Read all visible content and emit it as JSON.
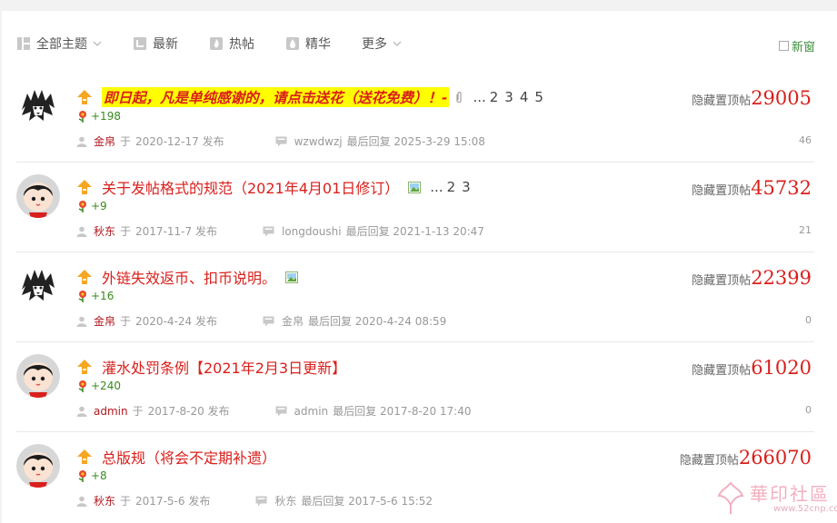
{
  "filters": {
    "all_topics": "全部主题",
    "latest": "最新",
    "hot": "热帖",
    "digest": "精华",
    "more": "更多"
  },
  "new_window_label": "新窗",
  "threads": [
    {
      "title": "即日起，凡是单纯感谢的，请点击送花（送花免费）！-",
      "highlight": true,
      "has_attachment": true,
      "pages": [
        "...",
        "2",
        "3",
        "4",
        "5"
      ],
      "flowers": "+198",
      "author": "金帛",
      "posted_prefix": "于",
      "posted": "2020-12-17 发布",
      "last_user": "wzwdwzj",
      "last_reply": "最后回复 2025-3-29 15:08",
      "pin_label": "隐藏置顶帖",
      "views": "29005",
      "replies": "46",
      "avatar": "lion"
    },
    {
      "title": "关于发帖格式的规范（2021年4月01日修订）",
      "highlight": false,
      "has_image": true,
      "pages": [
        "...",
        "2",
        "3"
      ],
      "flowers": "+9",
      "author": "秋东",
      "posted_prefix": "于",
      "posted": "2017-11-7 发布",
      "last_user": "longdoushi",
      "last_reply": "最后回复 2021-1-13 20:47",
      "pin_label": "隐藏置顶帖",
      "views": "45732",
      "replies": "21",
      "avatar": "girl"
    },
    {
      "title": "外链失效返币、扣币说明。",
      "highlight": false,
      "has_image": true,
      "pages": [],
      "flowers": "+16",
      "author": "金帛",
      "posted_prefix": "于",
      "posted": "2020-4-24 发布",
      "last_user": "金帛",
      "last_reply": "最后回复 2020-4-24 08:59",
      "pin_label": "隐藏置顶帖",
      "views": "22399",
      "replies": "0",
      "avatar": "lion"
    },
    {
      "title": "灌水处罚条例【2021年2月3日更新】",
      "highlight": false,
      "pages": [],
      "flowers": "+240",
      "author": "admin",
      "posted_prefix": "于",
      "posted": "2017-8-20 发布",
      "last_user": "admin",
      "last_reply": "最后回复 2017-8-20 17:40",
      "pin_label": "隐藏置顶帖",
      "views": "61020",
      "replies": "0",
      "avatar": "girl"
    },
    {
      "title": "总版规（将会不定期补遗）",
      "highlight": false,
      "pages": [],
      "flowers": "+8",
      "author": "秋东",
      "posted_prefix": "于",
      "posted": "2017-5-6 发布",
      "last_user": "秋东",
      "last_reply": "最后回复 2017-5-6 15:52",
      "pin_label": "隐藏置顶帖",
      "views": "266070",
      "replies": "",
      "avatar": "girl"
    }
  ],
  "watermark": {
    "main": "華印社區",
    "sub": "www.52cnp.com"
  },
  "colors": {
    "title_red": "#d9201c",
    "highlight_yellow": "#ffff00",
    "flower_green": "#3a8a1f",
    "new_window_green": "#3d8e3d"
  }
}
